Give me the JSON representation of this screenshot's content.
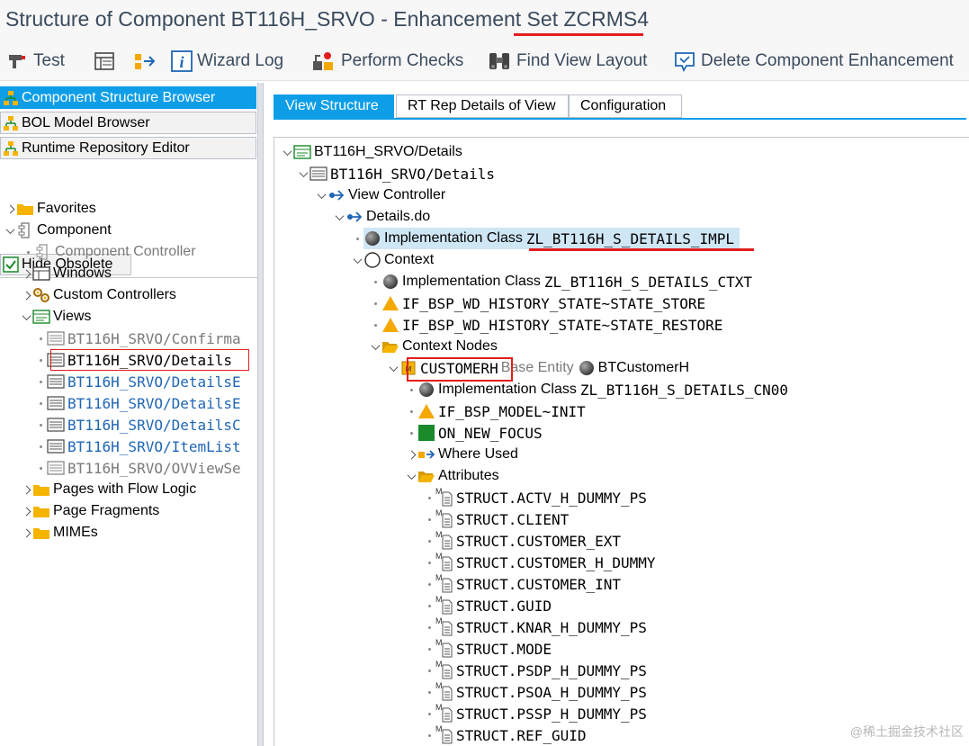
{
  "window": {
    "title": "Structure of Component BT116H_SRVO - Enhancement Set ZCRMS4"
  },
  "toolbar": {
    "test": "Test",
    "wizard_log": "Wizard Log",
    "perform_checks": "Perform Checks",
    "find_view_layout": "Find View Layout",
    "delete_enhancement": "Delete Component Enhancement"
  },
  "nav": {
    "component_structure_browser": "Component Structure Browser",
    "bol_model_browser": "BOL Model Browser",
    "runtime_repository_editor": "Runtime Repository Editor",
    "hide_obsolete": "Hide Obsolete"
  },
  "left_tree": {
    "favorites": "Favorites",
    "component": "Component",
    "component_controller": "Component Controller",
    "windows": "Windows",
    "custom_controllers": "Custom Controllers",
    "views": "Views",
    "view_items": [
      "BT116H_SRVO/Confirma",
      "BT116H_SRVO/Details",
      "BT116H_SRVO/DetailsE",
      "BT116H_SRVO/DetailsE",
      "BT116H_SRVO/DetailsC",
      "BT116H_SRVO/ItemList",
      "BT116H_SRVO/OVViewSe"
    ],
    "pages_with_flow_logic": "Pages with Flow Logic",
    "page_fragments": "Page Fragments",
    "mimes": "MIMEs"
  },
  "tabs": {
    "view_structure": "View Structure",
    "rt_rep_details": "RT Rep Details of View",
    "configuration": "Configuration"
  },
  "right_tree": {
    "root": "BT116H_SRVO/Details",
    "view": "BT116H_SRVO/Details",
    "view_controller": "View Controller",
    "details_do": "Details.do",
    "impl_class_label": "Implementation Class",
    "impl_class_value": "ZL_BT116H_S_DETAILS_IMPL",
    "context": "Context",
    "context_impl_value": "ZL_BT116H_S_DETAILS_CTXT",
    "state_store": "IF_BSP_WD_HISTORY_STATE~STATE_STORE",
    "state_restore": "IF_BSP_WD_HISTORY_STATE~STATE_RESTORE",
    "context_nodes": "Context Nodes",
    "customerh": "CUSTOMERH",
    "base_entity_label": "Base Entity",
    "base_entity_value": "BTCustomerH",
    "node_impl_value": "ZL_BT116H_S_DETAILS_CN00",
    "model_init": "IF_BSP_MODEL~INIT",
    "on_new_focus": "ON_NEW_FOCUS",
    "where_used": "Where Used",
    "attributes": "Attributes",
    "attribute_items": [
      "STRUCT.ACTV_H_DUMMY_PS",
      "STRUCT.CLIENT",
      "STRUCT.CUSTOMER_EXT",
      "STRUCT.CUSTOMER_H_DUMMY",
      "STRUCT.CUSTOMER_INT",
      "STRUCT.GUID",
      "STRUCT.KNAR_H_DUMMY_PS",
      "STRUCT.MODE",
      "STRUCT.PSDP_H_DUMMY_PS",
      "STRUCT.PSOA_H_DUMMY_PS",
      "STRUCT.PSSP_H_DUMMY_PS",
      "STRUCT.REF_GUID"
    ],
    "attribute_marker": "M"
  },
  "watermark": "@稀土掘金技术社区",
  "colors": {
    "accent": "#0e9ee8",
    "annotation_red": "#e31d1d",
    "folder": "#f5b400",
    "method_triangle": "#f5a800",
    "method_green": "#1a8a2a",
    "link_blue": "#1f66b5"
  }
}
